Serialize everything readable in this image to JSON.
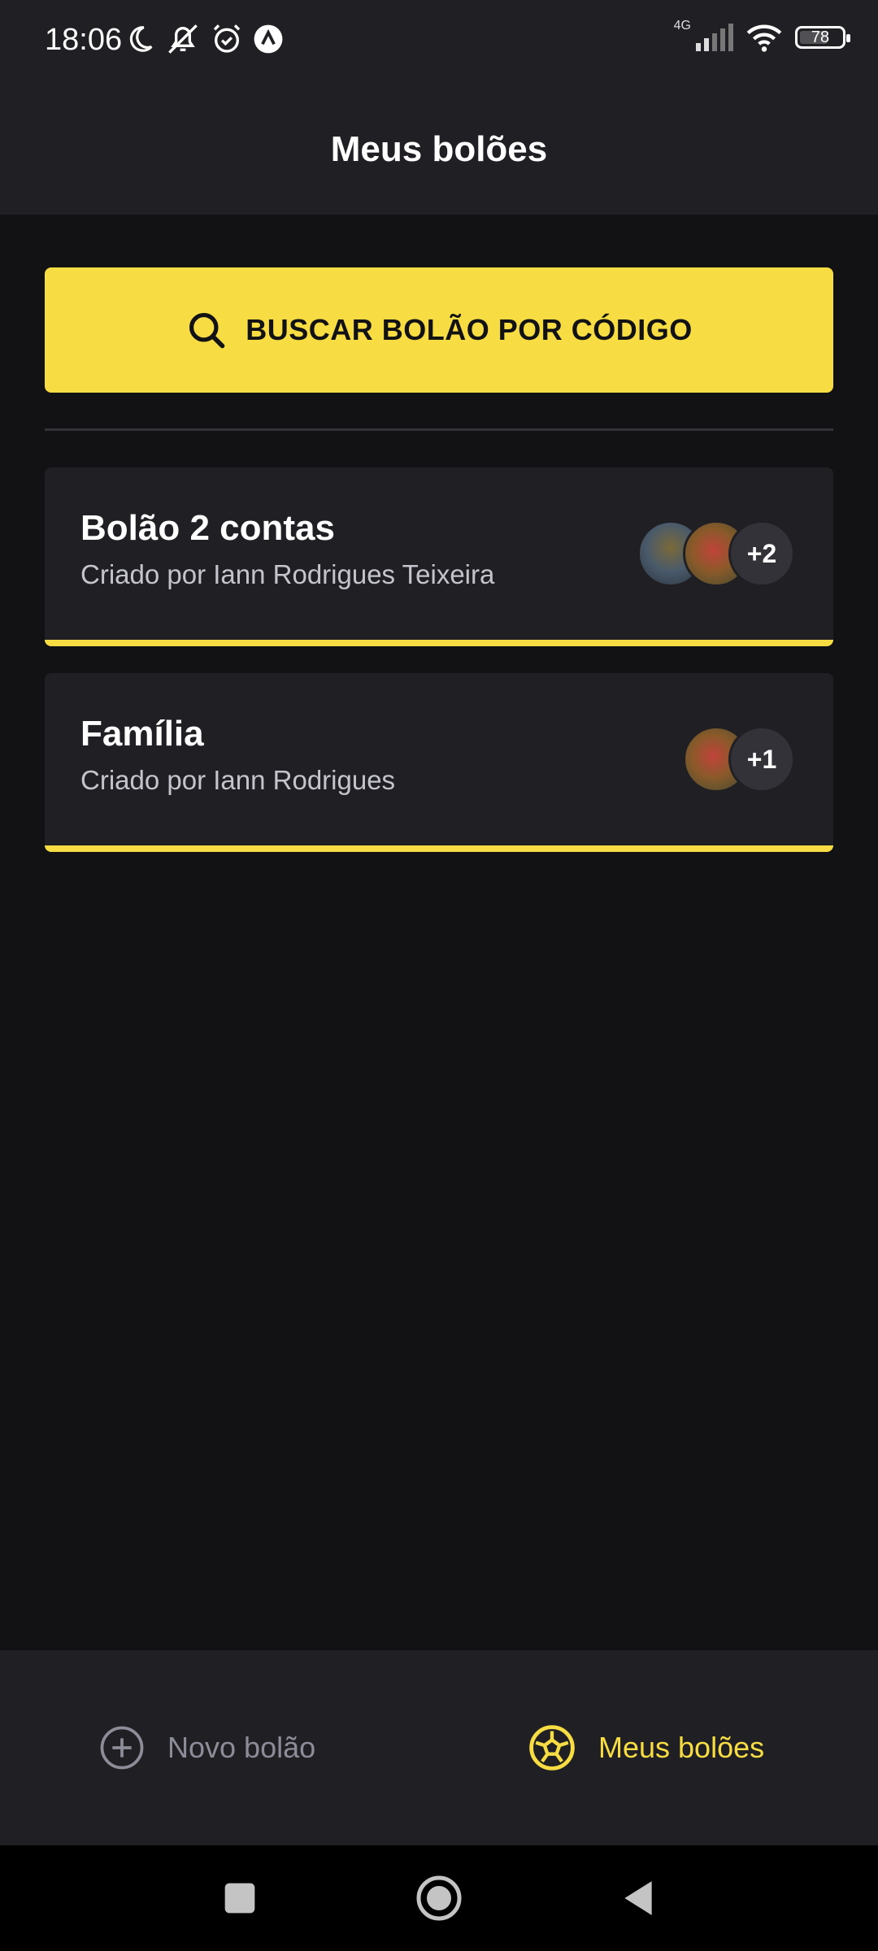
{
  "status_bar": {
    "time": "18:06",
    "network": "4G",
    "battery": "78",
    "left_icons": [
      "moon-icon",
      "bell-muted-icon",
      "alarm-icon",
      "app-notification-icon"
    ],
    "right_icons": [
      "signal-icon",
      "wifi-icon",
      "battery-icon"
    ]
  },
  "header": {
    "title": "Meus bolões"
  },
  "search_button": {
    "label": "BUSCAR BOLÃO POR CÓDIGO",
    "icon": "search-icon"
  },
  "pools": [
    {
      "title": "Bolão 2 contas",
      "owner": "Criado por Iann Rodrigues Teixeira",
      "extra_participants": "+2",
      "avatar_count": 2
    },
    {
      "title": "Família",
      "owner": "Criado por Iann Rodrigues",
      "extra_participants": "+1",
      "avatar_count": 1
    }
  ],
  "bottom_tabs": [
    {
      "label": "Novo bolão",
      "icon": "plus-circle-icon",
      "active": false
    },
    {
      "label": "Meus bolões",
      "icon": "soccer-ball-icon",
      "active": true
    }
  ],
  "colors": {
    "accent": "#F7DD43",
    "background": "#121214",
    "surface": "#202024",
    "muted": "#8d8d99"
  }
}
